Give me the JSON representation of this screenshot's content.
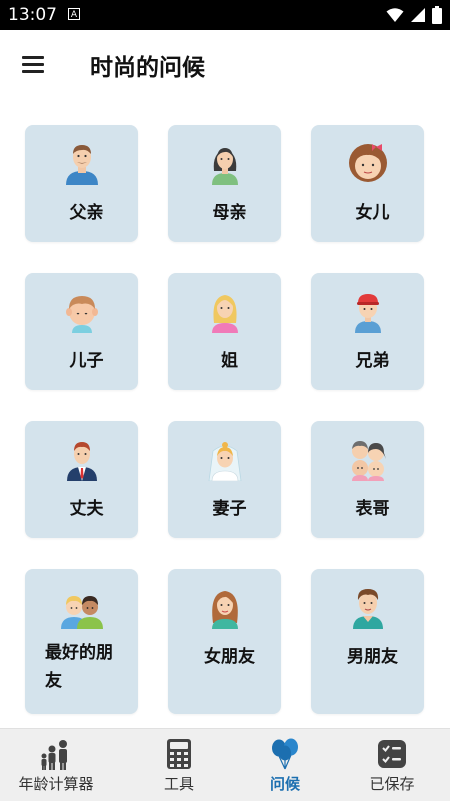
{
  "status": {
    "time": "13:07",
    "notification_glyph": "A"
  },
  "appbar": {
    "title": "时尚的问候"
  },
  "grid": {
    "items": [
      {
        "label": "父亲",
        "icon": "father-avatar-icon"
      },
      {
        "label": "母亲",
        "icon": "mother-avatar-icon"
      },
      {
        "label": "女儿",
        "icon": "daughter-avatar-icon"
      },
      {
        "label": "儿子",
        "icon": "son-avatar-icon"
      },
      {
        "label": "姐",
        "icon": "sister-avatar-icon"
      },
      {
        "label": "兄弟",
        "icon": "brother-avatar-icon"
      },
      {
        "label": "丈夫",
        "icon": "husband-avatar-icon"
      },
      {
        "label": "妻子",
        "icon": "wife-avatar-icon"
      },
      {
        "label": "表哥",
        "icon": "cousin-avatar-icon"
      },
      {
        "label": "最好的朋友",
        "icon": "best-friends-avatar-icon"
      },
      {
        "label": "女朋友",
        "icon": "girlfriend-avatar-icon"
      },
      {
        "label": "男朋友",
        "icon": "boyfriend-avatar-icon"
      }
    ]
  },
  "bottom_nav": {
    "items": [
      {
        "label": "年龄计算器",
        "icon": "family-icon",
        "active": false
      },
      {
        "label": "工具",
        "icon": "calculator-icon",
        "active": false
      },
      {
        "label": "问候",
        "icon": "balloons-icon",
        "active": true
      },
      {
        "label": "已保存",
        "icon": "checklist-icon",
        "active": false
      }
    ]
  },
  "colors": {
    "card_bg": "#d4e3ec",
    "accent": "#1c6fb0",
    "nav_bg": "#efefef",
    "status_bar": "#000000"
  }
}
